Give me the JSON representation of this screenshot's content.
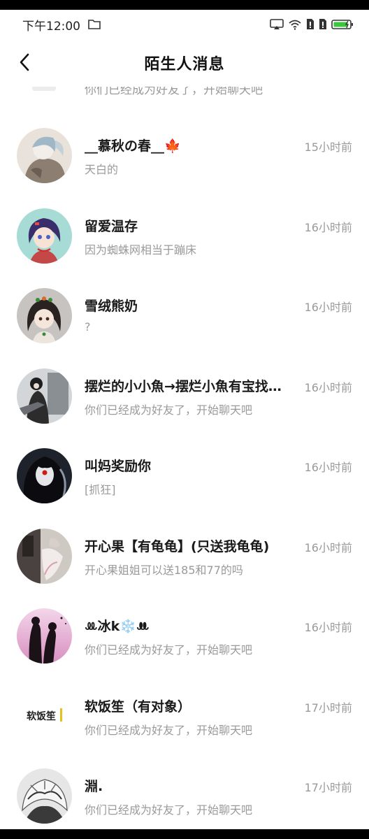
{
  "status_bar": {
    "time": "下午12:00",
    "icons": [
      "folder-icon",
      "cast-icon",
      "wifi-icon",
      "sim1-icon",
      "sim2-icon",
      "battery-icon"
    ]
  },
  "header": {
    "title": "陌生人消息",
    "back_icon": "chevron-left-icon"
  },
  "clipped_row": {
    "message": "你们已经成为好友了，开始聊天吧"
  },
  "conversations": [
    {
      "name": "__慕秋の春__🍁",
      "message": "天白的",
      "time": "15小时前"
    },
    {
      "name": "留爱温存",
      "message": "因为蜘蛛网相当于蹦床",
      "time": "16小时前"
    },
    {
      "name": "雪绒熊奶",
      "message": "?",
      "time": "16小时前"
    },
    {
      "name": "摆烂的小小魚→摆烂小魚有宝找…",
      "message": "你们已经成为好友了，开始聊天吧",
      "time": "16小时前"
    },
    {
      "name": "叫妈奖励你",
      "message": "[抓狂]",
      "time": "16小时前"
    },
    {
      "name": "开心果【有龟龟】(只送我龟龟)",
      "message": "开心果姐姐可以送185和77的吗",
      "time": "16小时前"
    },
    {
      "name": "ꔛ冰k❄️ꔚ",
      "message": "你们已经成为好友了，开始聊天吧",
      "time": "16小时前"
    },
    {
      "name": "软饭笙（有对象）",
      "message": "你们已经成为好友了，开始聊天吧",
      "time": "17小时前",
      "avatar_text": "软饭笙"
    },
    {
      "name": "淵.",
      "message": "你们已经成为好友了，开始聊天吧",
      "time": "17小时前"
    }
  ],
  "colors": {
    "text_primary": "#1a1a1a",
    "text_secondary": "#9a9a9a",
    "battery": "#3cc83c",
    "background": "#ffffff"
  }
}
